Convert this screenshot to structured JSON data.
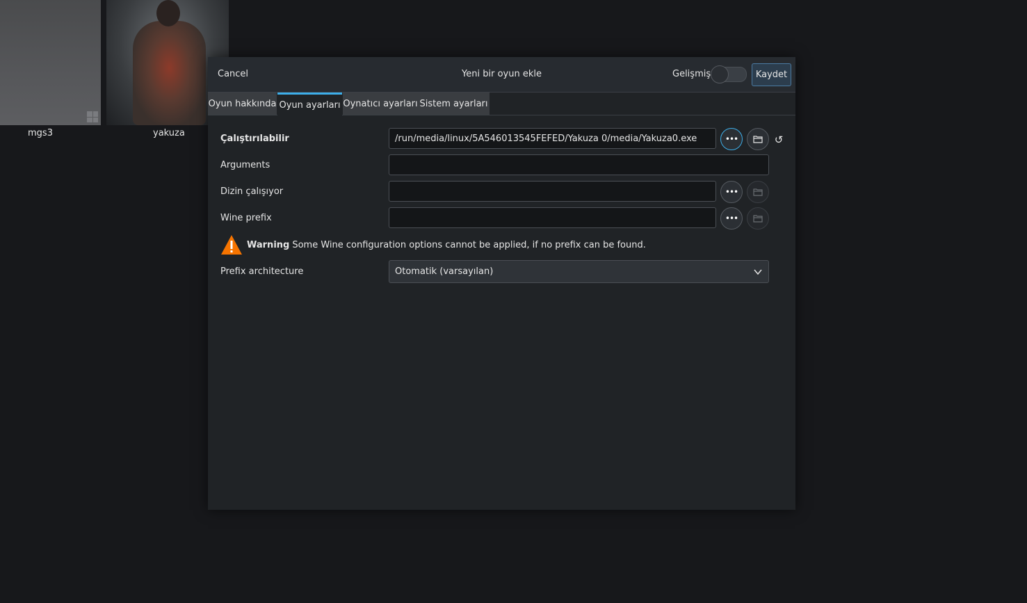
{
  "background_library": {
    "games": [
      {
        "name": "mgs3"
      },
      {
        "name": "yakuza"
      }
    ]
  },
  "dialog": {
    "cancel_label": "Cancel",
    "title": "Yeni bir oyun ekle",
    "advanced_label": "Gelişmiş",
    "advanced_enabled": false,
    "save_label": "Kaydet",
    "tabs": [
      {
        "label": "Oyun hakkında",
        "active": false
      },
      {
        "label": "Oyun ayarları",
        "active": true
      },
      {
        "label": "Oynatıcı ayarları",
        "active": false
      },
      {
        "label": "Sistem ayarları",
        "active": false
      }
    ],
    "form": {
      "executable": {
        "label": "Çalıştırılabilir",
        "value": "/run/media/linux/5A546013545FEFED/Yakuza 0/media/Yakuza0.exe"
      },
      "arguments": {
        "label": "Arguments",
        "value": ""
      },
      "working_dir": {
        "label": "Dizin çalışıyor",
        "value": ""
      },
      "wine_prefix": {
        "label": "Wine prefix",
        "value": ""
      },
      "warning": {
        "title": "Warning",
        "text": "Some Wine configuration options cannot be applied, if no prefix can be found."
      },
      "prefix_arch": {
        "label": "Prefix architecture",
        "selected": "Otomatik (varsayılan)"
      }
    }
  },
  "colors": {
    "accent": "#3daee9",
    "warning": "#f67400",
    "background": "#17181b",
    "dialog_bg": "#202326"
  }
}
